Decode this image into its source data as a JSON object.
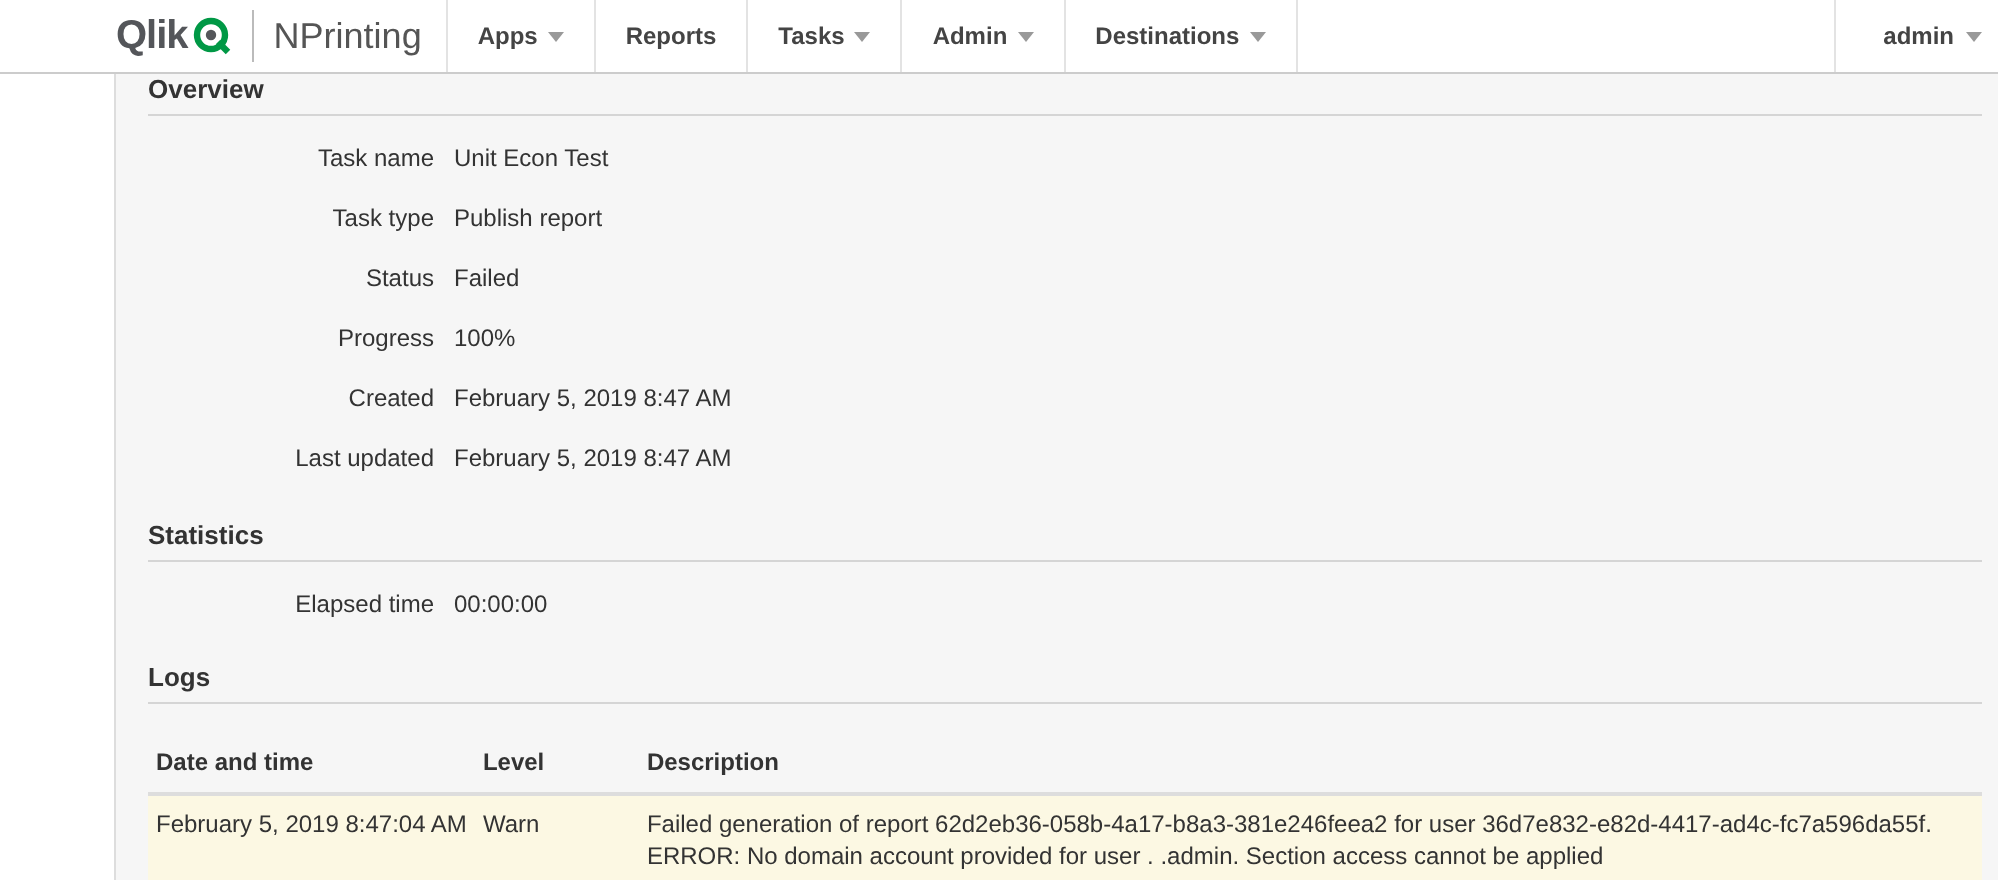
{
  "header": {
    "logo_text": "Qlik",
    "product": "NPrinting",
    "nav": [
      {
        "label": "Apps",
        "dropdown": true
      },
      {
        "label": "Reports",
        "dropdown": false
      },
      {
        "label": "Tasks",
        "dropdown": true
      },
      {
        "label": "Admin",
        "dropdown": true
      },
      {
        "label": "Destinations",
        "dropdown": true
      }
    ],
    "user": "admin"
  },
  "overview": {
    "title": "Overview",
    "fields": [
      {
        "label": "Task name",
        "value": "Unit Econ Test"
      },
      {
        "label": "Task type",
        "value": "Publish report"
      },
      {
        "label": "Status",
        "value": "Failed"
      },
      {
        "label": "Progress",
        "value": "100%"
      },
      {
        "label": "Created",
        "value": "February 5, 2019 8:47 AM"
      },
      {
        "label": "Last updated",
        "value": "February 5, 2019 8:47 AM"
      }
    ]
  },
  "statistics": {
    "title": "Statistics",
    "fields": [
      {
        "label": "Elapsed time",
        "value": "00:00:00"
      }
    ]
  },
  "logs": {
    "title": "Logs",
    "columns": [
      "Date and time",
      "Level",
      "Description"
    ],
    "rows": [
      {
        "cells": [
          "February 5, 2019 8:47:04 AM",
          "Warn",
          "Failed generation of report 62d2eb36-058b-4a17-b8a3-381e246feea2 for user 36d7e832-e82d-4417-ad4c-fc7a596da55f. ERROR: No domain account provided for user . .admin. Section access cannot be applied"
        ]
      }
    ]
  }
}
